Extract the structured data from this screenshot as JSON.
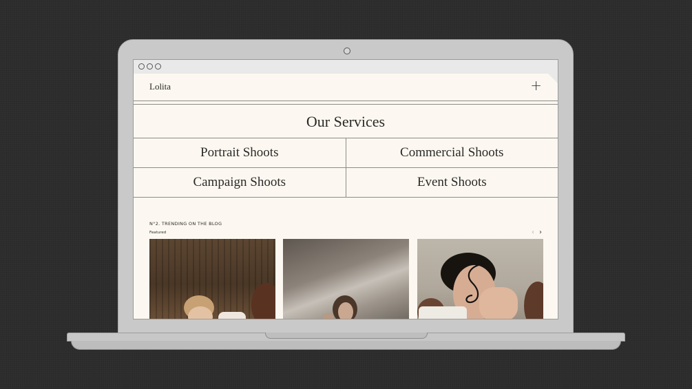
{
  "site": {
    "logo": "Lolita",
    "menu_icon": "plus-icon"
  },
  "services": {
    "title": "Our Services",
    "items": [
      "Portrait Shoots",
      "Commercial Shoots",
      "Campaign Shoots",
      "Event Shoots"
    ]
  },
  "blog": {
    "heading": "N°2. TRENDING ON THE BLOG",
    "subheading": "Featured",
    "prev_icon": "chevron-left-icon",
    "next_icon": "chevron-right-icon",
    "posts": [
      {
        "image": "woman-lying-wood-fence-photo"
      },
      {
        "image": "woman-sunlit-wall-photo"
      },
      {
        "image": "woman-curly-hair-portrait-photo"
      }
    ]
  },
  "colors": {
    "page_background": "#fcf8f1",
    "text": "#2b2926",
    "rule": "#8d8a85",
    "desk": "#2b2b2b"
  }
}
